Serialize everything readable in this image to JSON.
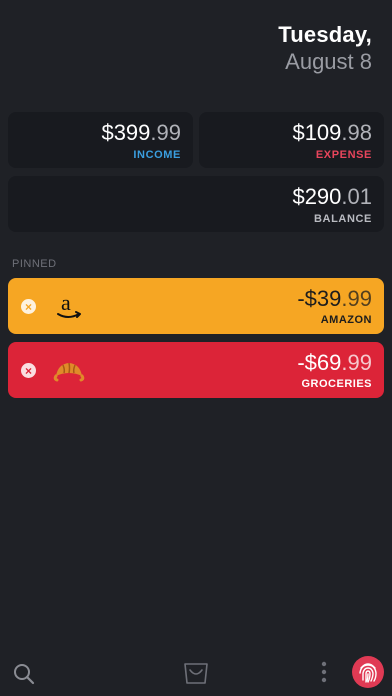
{
  "header": {
    "day": "Tuesday,",
    "date": "August 8"
  },
  "summary": {
    "income": {
      "dollars": "$399",
      "cents": ".99",
      "label": "INCOME",
      "color": "#3a9ee0"
    },
    "expense": {
      "dollars": "$109",
      "cents": ".98",
      "label": "EXPENSE",
      "color": "#e8455c"
    },
    "balance": {
      "dollars": "$290",
      "cents": ".01",
      "label": "BALANCE",
      "color": "#b9bbc1"
    }
  },
  "pinned": {
    "section_label": "PINNED",
    "items": [
      {
        "name": "AMAZON",
        "dollars": "-$39",
        "cents": ".99",
        "icon": "amazon-logo-icon",
        "color": "#f6a623"
      },
      {
        "name": "GROCERIES",
        "dollars": "-$69",
        "cents": ".99",
        "icon": "croissant-icon",
        "color": "#dc2438"
      }
    ]
  },
  "remove_glyph": "×",
  "bottom_bar": {
    "icons": [
      "search-icon",
      "shopping-bag-icon",
      "more-vertical-icon",
      "fingerprint-icon"
    ]
  }
}
